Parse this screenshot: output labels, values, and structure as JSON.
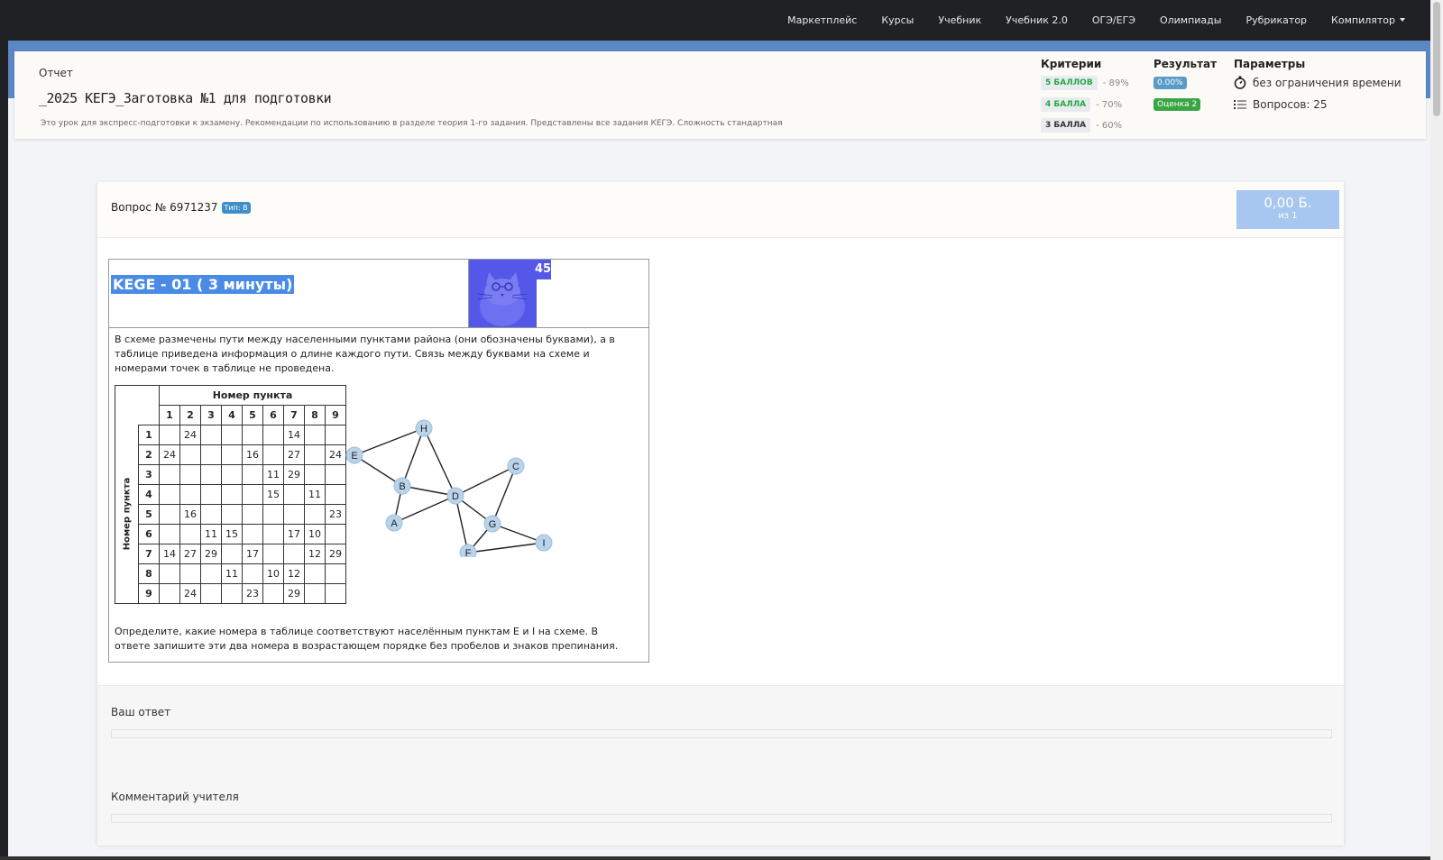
{
  "nav": {
    "items": [
      "Маркетплейс",
      "Курсы",
      "Учебник",
      "Учебник 2.0",
      "ОГЭ/ЕГЭ",
      "Олимпиады",
      "Рубрикатор",
      "Компилятор"
    ]
  },
  "header": {
    "report_label": "Отчет",
    "title": "_2025 КЕГЭ_Заготовка №1 для подготовки",
    "description": "Это урок для экспресс-подготовки к экзамену. Рекомендации по использованию в разделе теория 1-го задания. Представлены все задания КЕГЭ. Сложность стандартная",
    "criteria_head": "Критерии",
    "result_head": "Результат",
    "params_head": "Параметры",
    "criteria": [
      {
        "label": "5 БАЛЛОВ",
        "pct": "- 89%",
        "color": "#28a745"
      },
      {
        "label": "4 БАЛЛА",
        "pct": "- 70%",
        "color": "#28a745"
      },
      {
        "label": "3 БАЛЛА",
        "pct": "- 60%",
        "color": "#333333"
      }
    ],
    "result_pct": "0.00%",
    "result_grade": "Оценка 2",
    "param_time": "без ограничения времени",
    "param_questions": "Вопросов: 25"
  },
  "question": {
    "number_label": "Вопрос № 6971237",
    "type_badge": "Тип: В",
    "score": "0,00 Б.",
    "score_of": "из 1",
    "title": "KEGE - 01 ( 3 минуты)",
    "timer_badge": "45",
    "text1": "В схеме размечены пути между населенными пунктами района (они обозначены буквами), а в таблице приведена информация о длине каждого пути. Связь между буквами на схеме и номерами точек в таблице не проведена.",
    "text2": "Определите, какие номера в таблице соответствуют населённым пунктам Е и I на схеме. В ответе запишите эти два номера в возрастающем порядке без пробелов и знаков препинания.",
    "table_header": "Номер пункта",
    "table_side": "Номер пункта",
    "table_cols": [
      "1",
      "2",
      "3",
      "4",
      "5",
      "6",
      "7",
      "8",
      "9"
    ],
    "table_rows": [
      [
        "",
        "24",
        "",
        "",
        "",
        "",
        "14",
        "",
        ""
      ],
      [
        "24",
        "",
        "",
        "",
        "16",
        "",
        "27",
        "",
        "24"
      ],
      [
        "",
        "",
        "",
        "",
        "",
        "11",
        "29",
        "",
        ""
      ],
      [
        "",
        "",
        "",
        "",
        "",
        "15",
        "",
        "11",
        ""
      ],
      [
        "",
        "16",
        "",
        "",
        "",
        "",
        "",
        "",
        "23"
      ],
      [
        "",
        "",
        "11",
        "15",
        "",
        "",
        "17",
        "10",
        ""
      ],
      [
        "14",
        "27",
        "29",
        "",
        "17",
        "",
        "",
        "12",
        "29"
      ],
      [
        "",
        "",
        "",
        "11",
        "",
        "10",
        "12",
        "",
        ""
      ],
      [
        "",
        "24",
        "",
        "",
        "23",
        "",
        "29",
        "",
        ""
      ]
    ],
    "graph_nodes": [
      "H",
      "E",
      "C",
      "B",
      "D",
      "A",
      "G",
      "I",
      "F"
    ],
    "answer_label": "Ваш ответ",
    "comment_label": "Комментарий учителя"
  }
}
